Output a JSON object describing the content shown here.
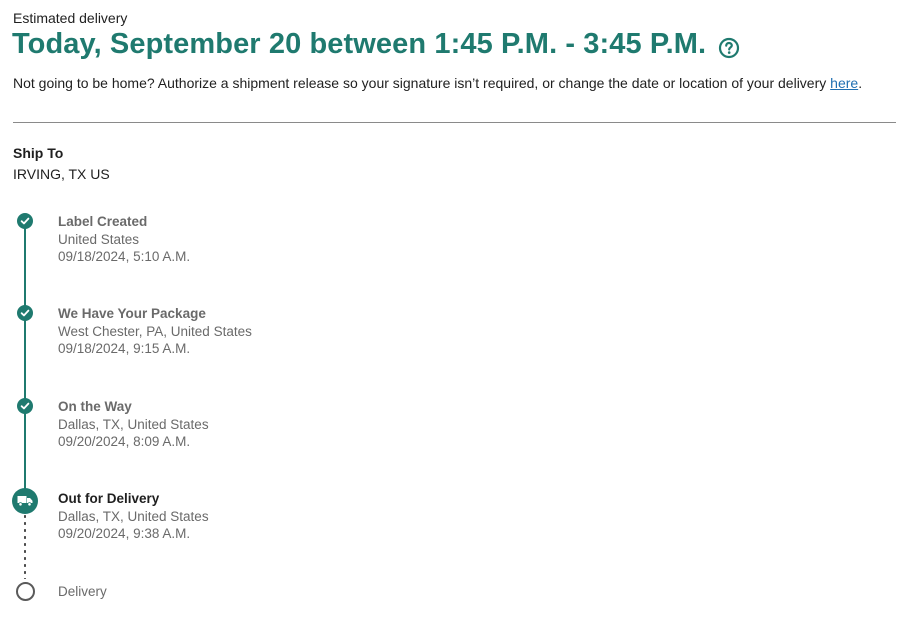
{
  "estimate": {
    "label": "Estimated delivery",
    "headline": "Today, September 20 between 1:45 P.M. - 3:45 P.M.",
    "help_icon": "question-circle-icon"
  },
  "notice": {
    "text": "Not going to be home? Authorize a shipment release so your signature isn’t required, or change the date or location of your delivery ",
    "link": "here",
    "trail": "."
  },
  "ship_to": {
    "label": "Ship To",
    "value": "IRVING, TX US"
  },
  "colors": {
    "accent": "#1f7a6f",
    "link": "#1f6fb2"
  },
  "steps": [
    {
      "title": "Label Created",
      "location": "United States",
      "time": "09/18/2024, 5:10 A.M.",
      "status": "complete",
      "icon": "check-icon"
    },
    {
      "title": "We Have Your Package",
      "location": "West Chester, PA, United States",
      "time": "09/18/2024, 9:15 A.M.",
      "status": "complete",
      "icon": "check-icon"
    },
    {
      "title": "On the Way",
      "location": "Dallas, TX, United States",
      "time": "09/20/2024, 8:09 A.M.",
      "status": "complete",
      "icon": "check-icon"
    },
    {
      "title": "Out for Delivery",
      "location": "Dallas, TX, United States",
      "time": "09/20/2024, 9:38 A.M.",
      "status": "current",
      "icon": "truck-icon"
    },
    {
      "title": "Delivery",
      "status": "pending",
      "icon": "empty-circle-icon"
    }
  ]
}
